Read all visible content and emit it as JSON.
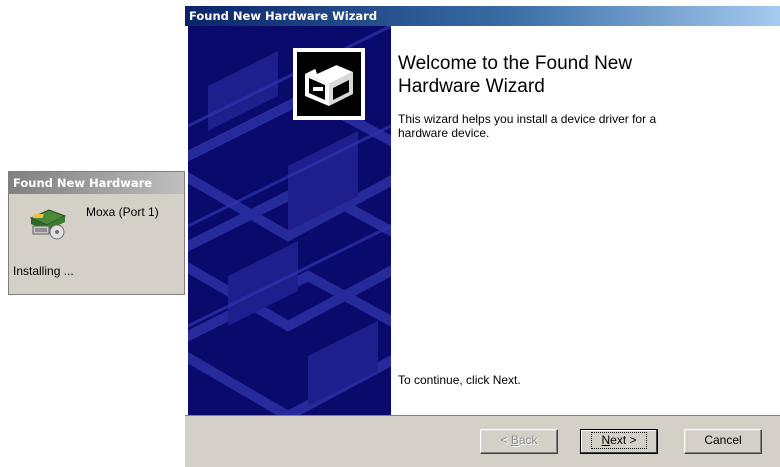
{
  "popup": {
    "title": "Found New Hardware",
    "device_name": "Moxa (Port 1)",
    "status": "Installing ...",
    "icon": "hardware-device-icon"
  },
  "wizard": {
    "title": "Found New Hardware Wizard",
    "logo_icon": "hardware-wizard-icon",
    "heading": "Welcome to the Found New Hardware Wizard",
    "description": "This wizard helps you install a device driver for a hardware device.",
    "continue_hint": "To continue, click Next.",
    "buttons": {
      "back": {
        "prefix": "< ",
        "accel": "B",
        "rest": "ack",
        "enabled": false
      },
      "next": {
        "accel": "N",
        "rest": "ext >",
        "enabled": true
      },
      "cancel": {
        "label": "Cancel",
        "enabled": true
      }
    }
  },
  "colors": {
    "title_active": "#0a246a",
    "title_inactive": "#808080",
    "side_panel": "#0a0a6c",
    "dialog_face": "#d4d0c8"
  }
}
